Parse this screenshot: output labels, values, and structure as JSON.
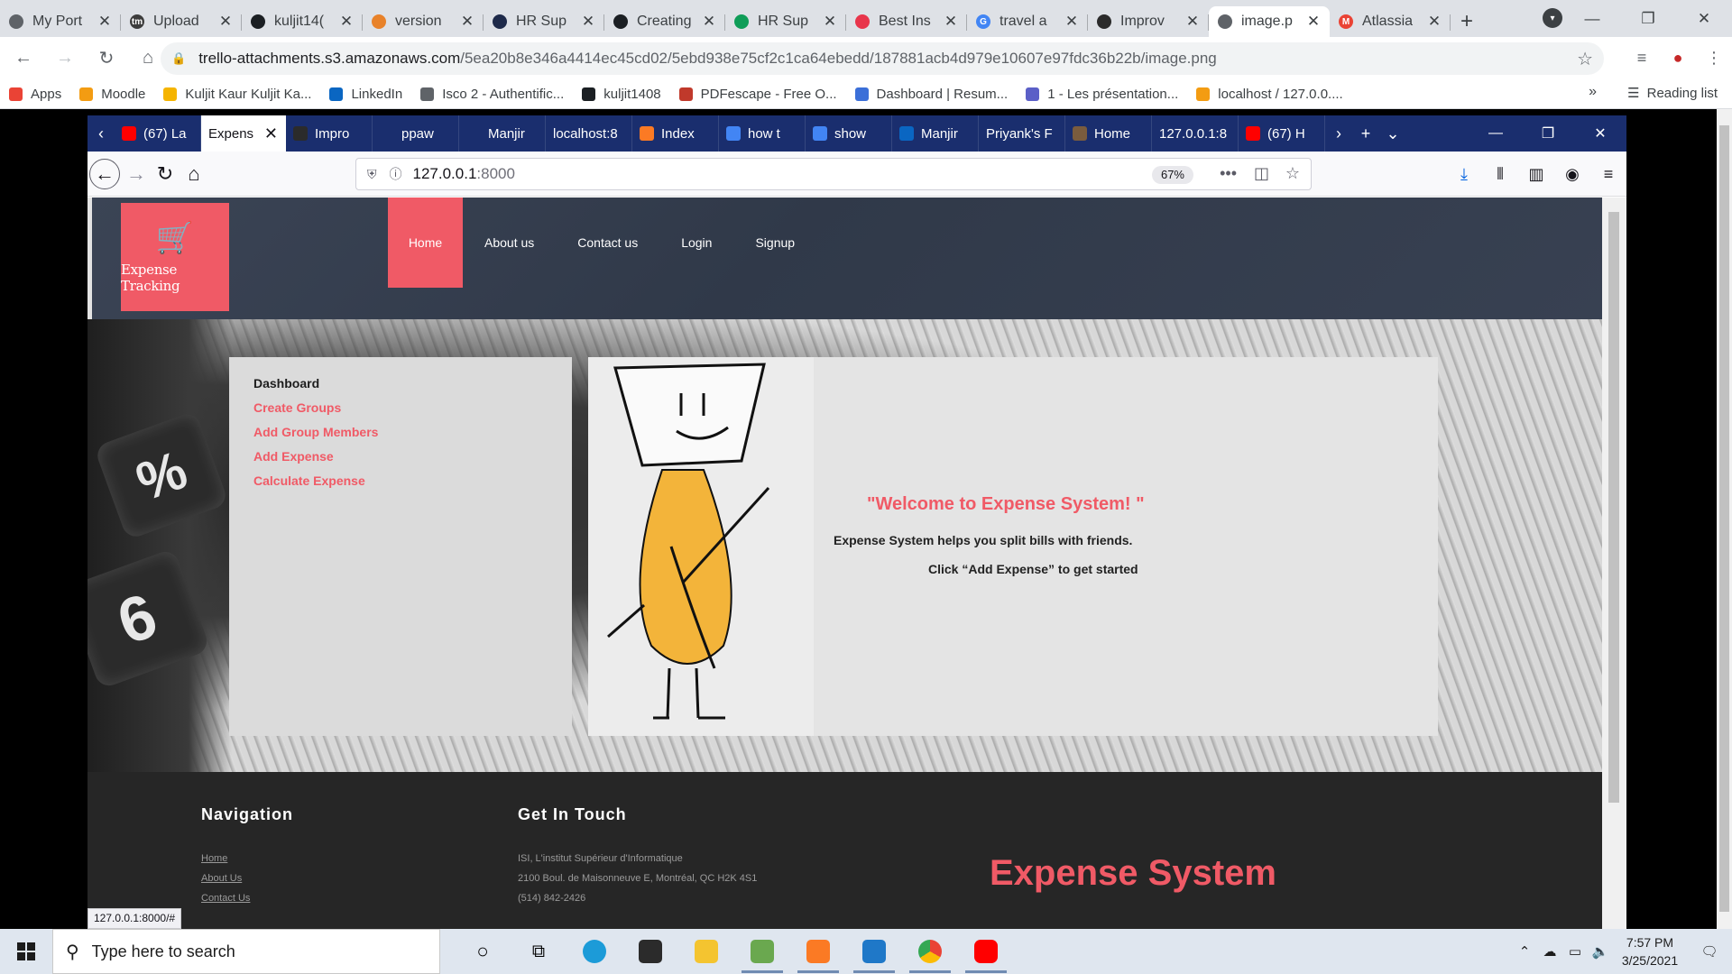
{
  "chrome": {
    "tabs": [
      {
        "title": "My Port",
        "fav": "#5f6368",
        "glyph": ""
      },
      {
        "title": "Upload",
        "fav": "#3c3c3c",
        "glyph": "tm"
      },
      {
        "title": "kuljit14(",
        "fav": "#1b1f23",
        "glyph": ""
      },
      {
        "title": "version",
        "fav": "#e8822a",
        "glyph": ""
      },
      {
        "title": "HR Sup",
        "fav": "#1e2a4a",
        "glyph": ""
      },
      {
        "title": "Creating",
        "fav": "#1b1f23",
        "glyph": ""
      },
      {
        "title": "HR Sup",
        "fav": "#0f9d58",
        "glyph": ""
      },
      {
        "title": "Best Ins",
        "fav": "#e8354b",
        "glyph": ""
      },
      {
        "title": "travel a",
        "fav": "#4285f4",
        "glyph": "G"
      },
      {
        "title": "Improv",
        "fav": "#2b2b2b",
        "glyph": ""
      },
      {
        "title": "image.p",
        "fav": "#5f6368",
        "glyph": ""
      },
      {
        "title": "Atlassia",
        "fav": "#ea4335",
        "glyph": "M"
      }
    ],
    "active_tab": 10,
    "url_host": "trello-attachments.s3.amazonaws.com",
    "url_path": "/5ea20b8e346a4414ec45cd02/5ebd938e75cf2c1ca64ebedd/187881acb4d979e10607e97fdc36b22b/image.png",
    "bookmarks": [
      {
        "label": "Apps",
        "color": "#ea4335"
      },
      {
        "label": "Moodle",
        "color": "#f39c12"
      },
      {
        "label": "Kuljit Kaur Kuljit Ka...",
        "color": "#f5b400"
      },
      {
        "label": "LinkedIn",
        "color": "#0a66c2"
      },
      {
        "label": "Isco 2 - Authentific...",
        "color": "#5f6368"
      },
      {
        "label": "kuljit1408",
        "color": "#1b1f23"
      },
      {
        "label": "PDFescape - Free O...",
        "color": "#c0392b"
      },
      {
        "label": "Dashboard | Resum...",
        "color": "#3b6fd8"
      },
      {
        "label": "1 - Les présentation...",
        "color": "#5b5fc7"
      },
      {
        "label": "localhost / 127.0.0....",
        "color": "#f39c12"
      }
    ],
    "reading_list": "Reading list"
  },
  "firefox": {
    "tabs": [
      {
        "title": "(67) La",
        "fav": "#ff0000"
      },
      {
        "title": "Expens",
        "fav": "",
        "active": true
      },
      {
        "title": "Impro",
        "fav": "#2b2b2b"
      },
      {
        "title": "ppaw",
        "fav": "#1a2e6e"
      },
      {
        "title": "Manjir",
        "fav": "#1a2e6e"
      },
      {
        "title": "localhost:8",
        "fav": ""
      },
      {
        "title": "Index",
        "fav": "#fb7a24"
      },
      {
        "title": "how t",
        "fav": "#4285f4"
      },
      {
        "title": "show",
        "fav": "#4285f4"
      },
      {
        "title": "Manjir",
        "fav": "#0a66c2"
      },
      {
        "title": "Priyank's F",
        "fav": ""
      },
      {
        "title": "Home",
        "fav": "#7a5c3e"
      },
      {
        "title": "127.0.0.1:8",
        "fav": ""
      },
      {
        "title": "(67) H",
        "fav": "#ff0000"
      }
    ],
    "url_main": "127.0.0.1",
    "url_port": ":8000",
    "zoom": "67%"
  },
  "site": {
    "logo_text": "Expense Tracking",
    "nav": [
      "Home",
      "About us",
      "Contact us",
      "Login",
      "Signup"
    ],
    "sidebar": {
      "title": "Dashboard",
      "links": [
        "Create Groups",
        "Add Group Members",
        "Add Expense",
        "Calculate Expense"
      ]
    },
    "welcome": {
      "title": "\"Welcome to Expense System! \"",
      "subtitle": "Expense System helps you split bills with friends.",
      "cta": "Click “Add Expense” to get started"
    },
    "footer": {
      "nav_title": "Navigation",
      "nav_links": [
        "Home",
        "About Us",
        "Contact Us"
      ],
      "contact_title": "Get In Touch",
      "contact_lines": [
        "ISI, L'institut Supérieur d'Informatique",
        "2100 Boul. de Maisonneuve E, Montréal, QC H2K 4S1",
        "(514) 842-2426"
      ],
      "brand": "Expense System"
    },
    "status_url": "127.0.0.1:8000/#"
  },
  "taskbar": {
    "search_placeholder": "Type here to search",
    "time": "7:57 PM",
    "date": "3/25/2021"
  }
}
